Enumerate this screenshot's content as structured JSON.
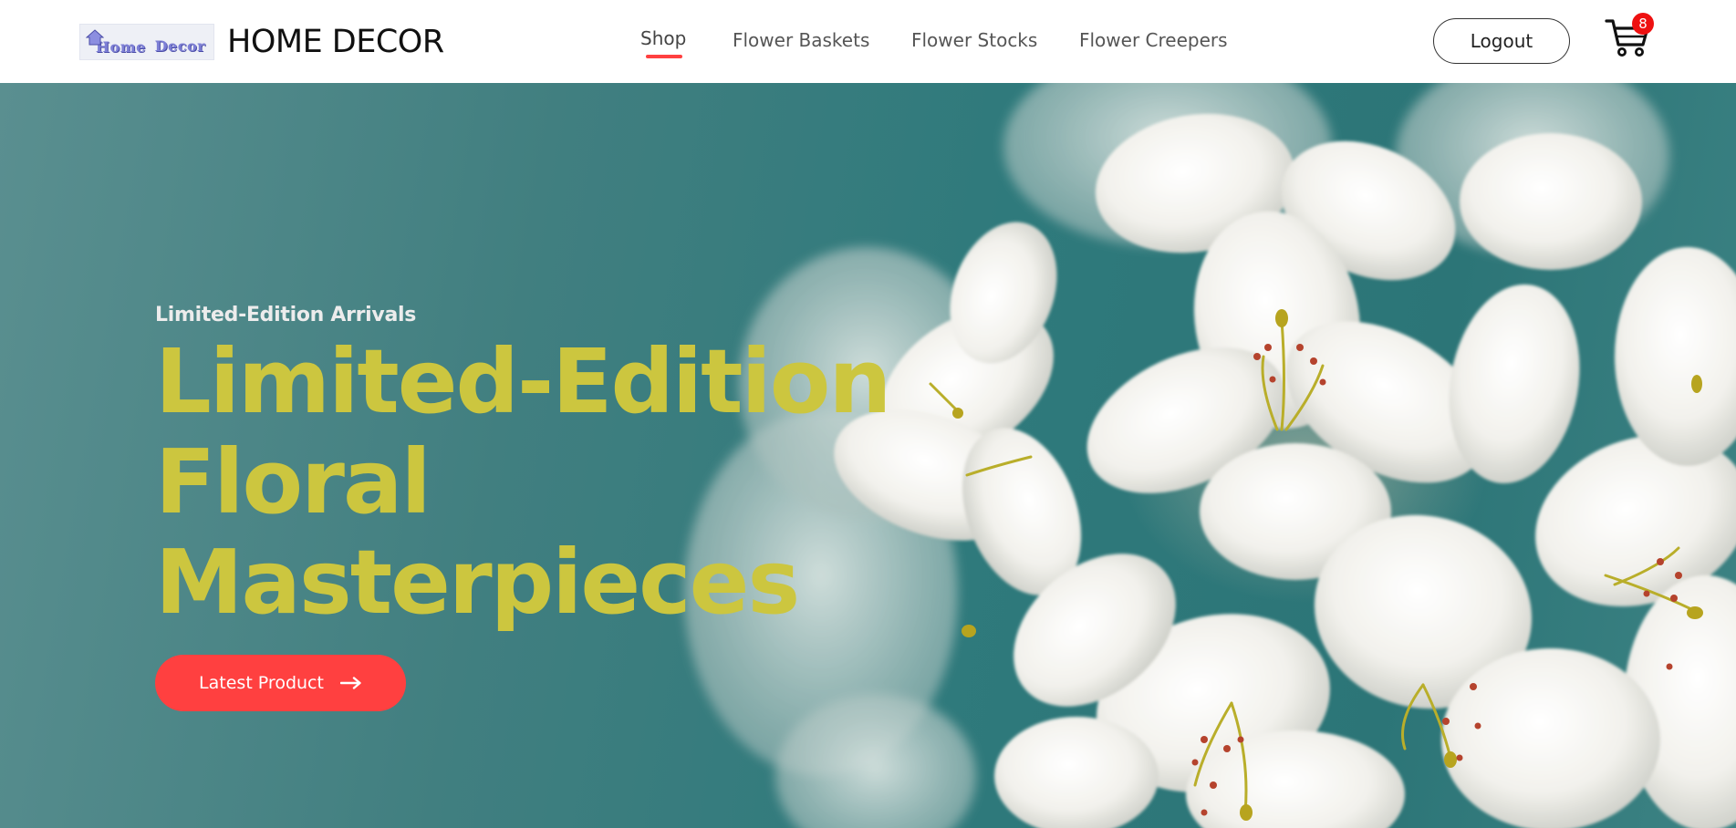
{
  "brand": {
    "logo_words": [
      "Home",
      "Decor"
    ],
    "title": "HOME DECOR"
  },
  "nav": {
    "items": [
      {
        "label": "Shop",
        "active": true
      },
      {
        "label": "Flower Baskets",
        "active": false
      },
      {
        "label": "Flower Stocks",
        "active": false
      },
      {
        "label": "Flower Creepers",
        "active": false
      }
    ]
  },
  "header_actions": {
    "logout_label": "Logout",
    "cart_icon": "shopping-cart-icon",
    "cart_count": "8"
  },
  "hero": {
    "eyebrow": "Limited-Edition Arrivals",
    "headline_lines": [
      "Limited-Edition",
      "Floral",
      "Masterpieces"
    ],
    "cta_label": "Latest Product",
    "cta_icon": "arrow-right-icon",
    "image_subject": "white-lily-bouquet"
  },
  "colors": {
    "accent": "#ff4040",
    "headline": "#ccc63f",
    "hero_background": "#2f7a7c",
    "badge": "#ee1111"
  }
}
